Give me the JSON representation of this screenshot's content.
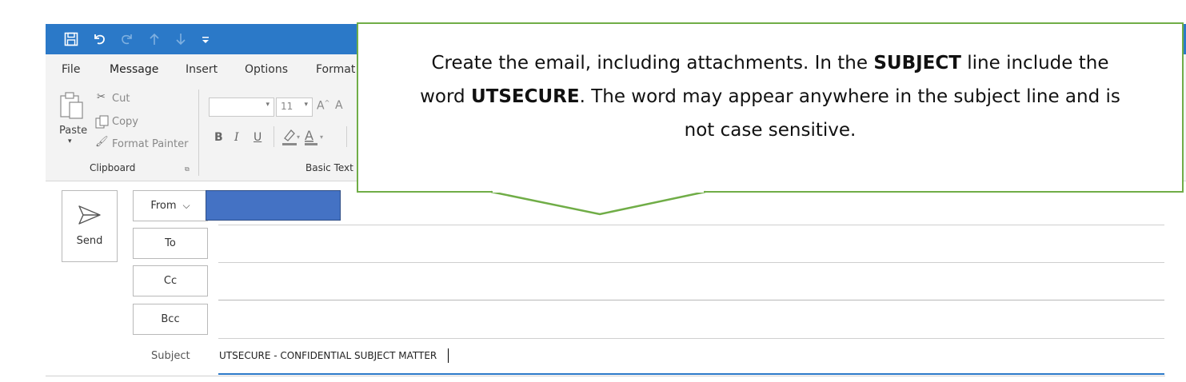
{
  "quick_access": {
    "icons": [
      "save-icon",
      "undo-icon",
      "redo-icon",
      "up-arrow-icon",
      "down-arrow-icon",
      "customize-icon"
    ]
  },
  "ribbon": {
    "tabs": [
      {
        "label": "File"
      },
      {
        "label": "Message"
      },
      {
        "label": "Insert"
      },
      {
        "label": "Options"
      },
      {
        "label": "Format"
      }
    ],
    "clipboard": {
      "paste": "Paste",
      "cut": "Cut",
      "copy": "Copy",
      "format_painter": "Format Painter",
      "group_label": "Clipboard"
    },
    "basic_text": {
      "font_size": "11",
      "bold": "B",
      "italic": "I",
      "underline": "U",
      "group_label": "Basic Text"
    }
  },
  "compose": {
    "send_label": "Send",
    "from_label": "From",
    "to_label": "To",
    "cc_label": "Cc",
    "bcc_label": "Bcc",
    "subject_label": "Subject",
    "subject_value": "UTSECURE - CONFIDENTIAL SUBJECT MATTER"
  },
  "callout": {
    "line1_a": "Create the email, including attachments.  In the ",
    "line1_bold": "SUBJECT",
    "line1_b": " line include the",
    "line2_a": "word ",
    "line2_bold": "UTSECURE",
    "line2_b": ".  The word may appear anywhere in the subject line and is",
    "line3": "not case sensitive."
  },
  "colors": {
    "titlebar": "#2b79c8",
    "callout_border": "#70ad47",
    "from_account_fill": "#4472c4",
    "subject_underline": "#2b79c8"
  }
}
